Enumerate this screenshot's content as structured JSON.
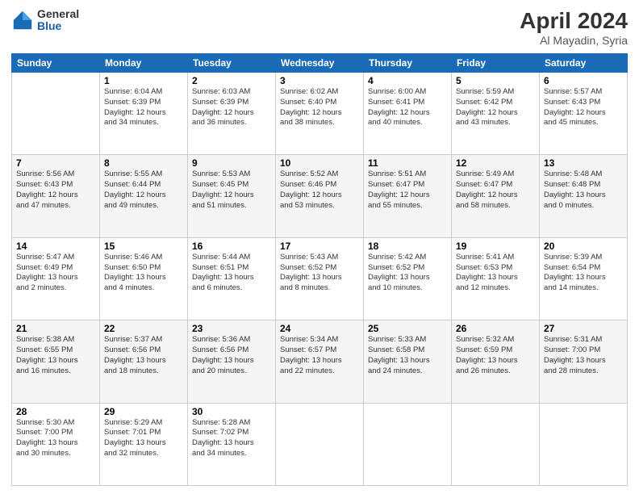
{
  "logo": {
    "general": "General",
    "blue": "Blue"
  },
  "title": {
    "month": "April 2024",
    "location": "Al Mayadin, Syria"
  },
  "headers": [
    "Sunday",
    "Monday",
    "Tuesday",
    "Wednesday",
    "Thursday",
    "Friday",
    "Saturday"
  ],
  "weeks": [
    [
      {
        "day": "",
        "info": ""
      },
      {
        "day": "1",
        "info": "Sunrise: 6:04 AM\nSunset: 6:39 PM\nDaylight: 12 hours\nand 34 minutes."
      },
      {
        "day": "2",
        "info": "Sunrise: 6:03 AM\nSunset: 6:39 PM\nDaylight: 12 hours\nand 36 minutes."
      },
      {
        "day": "3",
        "info": "Sunrise: 6:02 AM\nSunset: 6:40 PM\nDaylight: 12 hours\nand 38 minutes."
      },
      {
        "day": "4",
        "info": "Sunrise: 6:00 AM\nSunset: 6:41 PM\nDaylight: 12 hours\nand 40 minutes."
      },
      {
        "day": "5",
        "info": "Sunrise: 5:59 AM\nSunset: 6:42 PM\nDaylight: 12 hours\nand 43 minutes."
      },
      {
        "day": "6",
        "info": "Sunrise: 5:57 AM\nSunset: 6:43 PM\nDaylight: 12 hours\nand 45 minutes."
      }
    ],
    [
      {
        "day": "7",
        "info": "Sunrise: 5:56 AM\nSunset: 6:43 PM\nDaylight: 12 hours\nand 47 minutes."
      },
      {
        "day": "8",
        "info": "Sunrise: 5:55 AM\nSunset: 6:44 PM\nDaylight: 12 hours\nand 49 minutes."
      },
      {
        "day": "9",
        "info": "Sunrise: 5:53 AM\nSunset: 6:45 PM\nDaylight: 12 hours\nand 51 minutes."
      },
      {
        "day": "10",
        "info": "Sunrise: 5:52 AM\nSunset: 6:46 PM\nDaylight: 12 hours\nand 53 minutes."
      },
      {
        "day": "11",
        "info": "Sunrise: 5:51 AM\nSunset: 6:47 PM\nDaylight: 12 hours\nand 55 minutes."
      },
      {
        "day": "12",
        "info": "Sunrise: 5:49 AM\nSunset: 6:47 PM\nDaylight: 12 hours\nand 58 minutes."
      },
      {
        "day": "13",
        "info": "Sunrise: 5:48 AM\nSunset: 6:48 PM\nDaylight: 13 hours\nand 0 minutes."
      }
    ],
    [
      {
        "day": "14",
        "info": "Sunrise: 5:47 AM\nSunset: 6:49 PM\nDaylight: 13 hours\nand 2 minutes."
      },
      {
        "day": "15",
        "info": "Sunrise: 5:46 AM\nSunset: 6:50 PM\nDaylight: 13 hours\nand 4 minutes."
      },
      {
        "day": "16",
        "info": "Sunrise: 5:44 AM\nSunset: 6:51 PM\nDaylight: 13 hours\nand 6 minutes."
      },
      {
        "day": "17",
        "info": "Sunrise: 5:43 AM\nSunset: 6:52 PM\nDaylight: 13 hours\nand 8 minutes."
      },
      {
        "day": "18",
        "info": "Sunrise: 5:42 AM\nSunset: 6:52 PM\nDaylight: 13 hours\nand 10 minutes."
      },
      {
        "day": "19",
        "info": "Sunrise: 5:41 AM\nSunset: 6:53 PM\nDaylight: 13 hours\nand 12 minutes."
      },
      {
        "day": "20",
        "info": "Sunrise: 5:39 AM\nSunset: 6:54 PM\nDaylight: 13 hours\nand 14 minutes."
      }
    ],
    [
      {
        "day": "21",
        "info": "Sunrise: 5:38 AM\nSunset: 6:55 PM\nDaylight: 13 hours\nand 16 minutes."
      },
      {
        "day": "22",
        "info": "Sunrise: 5:37 AM\nSunset: 6:56 PM\nDaylight: 13 hours\nand 18 minutes."
      },
      {
        "day": "23",
        "info": "Sunrise: 5:36 AM\nSunset: 6:56 PM\nDaylight: 13 hours\nand 20 minutes."
      },
      {
        "day": "24",
        "info": "Sunrise: 5:34 AM\nSunset: 6:57 PM\nDaylight: 13 hours\nand 22 minutes."
      },
      {
        "day": "25",
        "info": "Sunrise: 5:33 AM\nSunset: 6:58 PM\nDaylight: 13 hours\nand 24 minutes."
      },
      {
        "day": "26",
        "info": "Sunrise: 5:32 AM\nSunset: 6:59 PM\nDaylight: 13 hours\nand 26 minutes."
      },
      {
        "day": "27",
        "info": "Sunrise: 5:31 AM\nSunset: 7:00 PM\nDaylight: 13 hours\nand 28 minutes."
      }
    ],
    [
      {
        "day": "28",
        "info": "Sunrise: 5:30 AM\nSunset: 7:00 PM\nDaylight: 13 hours\nand 30 minutes."
      },
      {
        "day": "29",
        "info": "Sunrise: 5:29 AM\nSunset: 7:01 PM\nDaylight: 13 hours\nand 32 minutes."
      },
      {
        "day": "30",
        "info": "Sunrise: 5:28 AM\nSunset: 7:02 PM\nDaylight: 13 hours\nand 34 minutes."
      },
      {
        "day": "",
        "info": ""
      },
      {
        "day": "",
        "info": ""
      },
      {
        "day": "",
        "info": ""
      },
      {
        "day": "",
        "info": ""
      }
    ]
  ]
}
